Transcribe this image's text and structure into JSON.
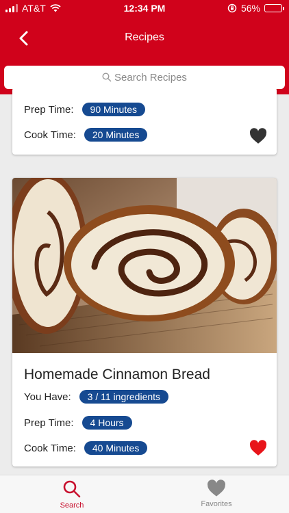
{
  "status_bar": {
    "carrier": "AT&T",
    "time": "12:34 PM",
    "battery": "56%",
    "battery_level": 0.56
  },
  "header": {
    "title": "Recipes"
  },
  "search": {
    "placeholder": "Search Recipes"
  },
  "cards": [
    {
      "prep_label": "Prep Time:",
      "prep_value": "90 Minutes",
      "cook_label": "Cook Time:",
      "cook_value": "20 Minutes",
      "favorite": false
    },
    {
      "title": "Homemade Cinnamon Bread",
      "have_label": "You Have:",
      "have_value": "3 / 11 ingredients",
      "prep_label": "Prep Time:",
      "prep_value": "4 Hours",
      "cook_label": "Cook Time:",
      "cook_value": "40 Minutes",
      "favorite": true
    }
  ],
  "tabbar": {
    "search_label": "Search",
    "favorites_label": "Favorites"
  },
  "colors": {
    "brand_red": "#d0021b",
    "pill_blue": "#164a91",
    "favorite_red": "#e8141a",
    "heart_dark": "#333333"
  }
}
